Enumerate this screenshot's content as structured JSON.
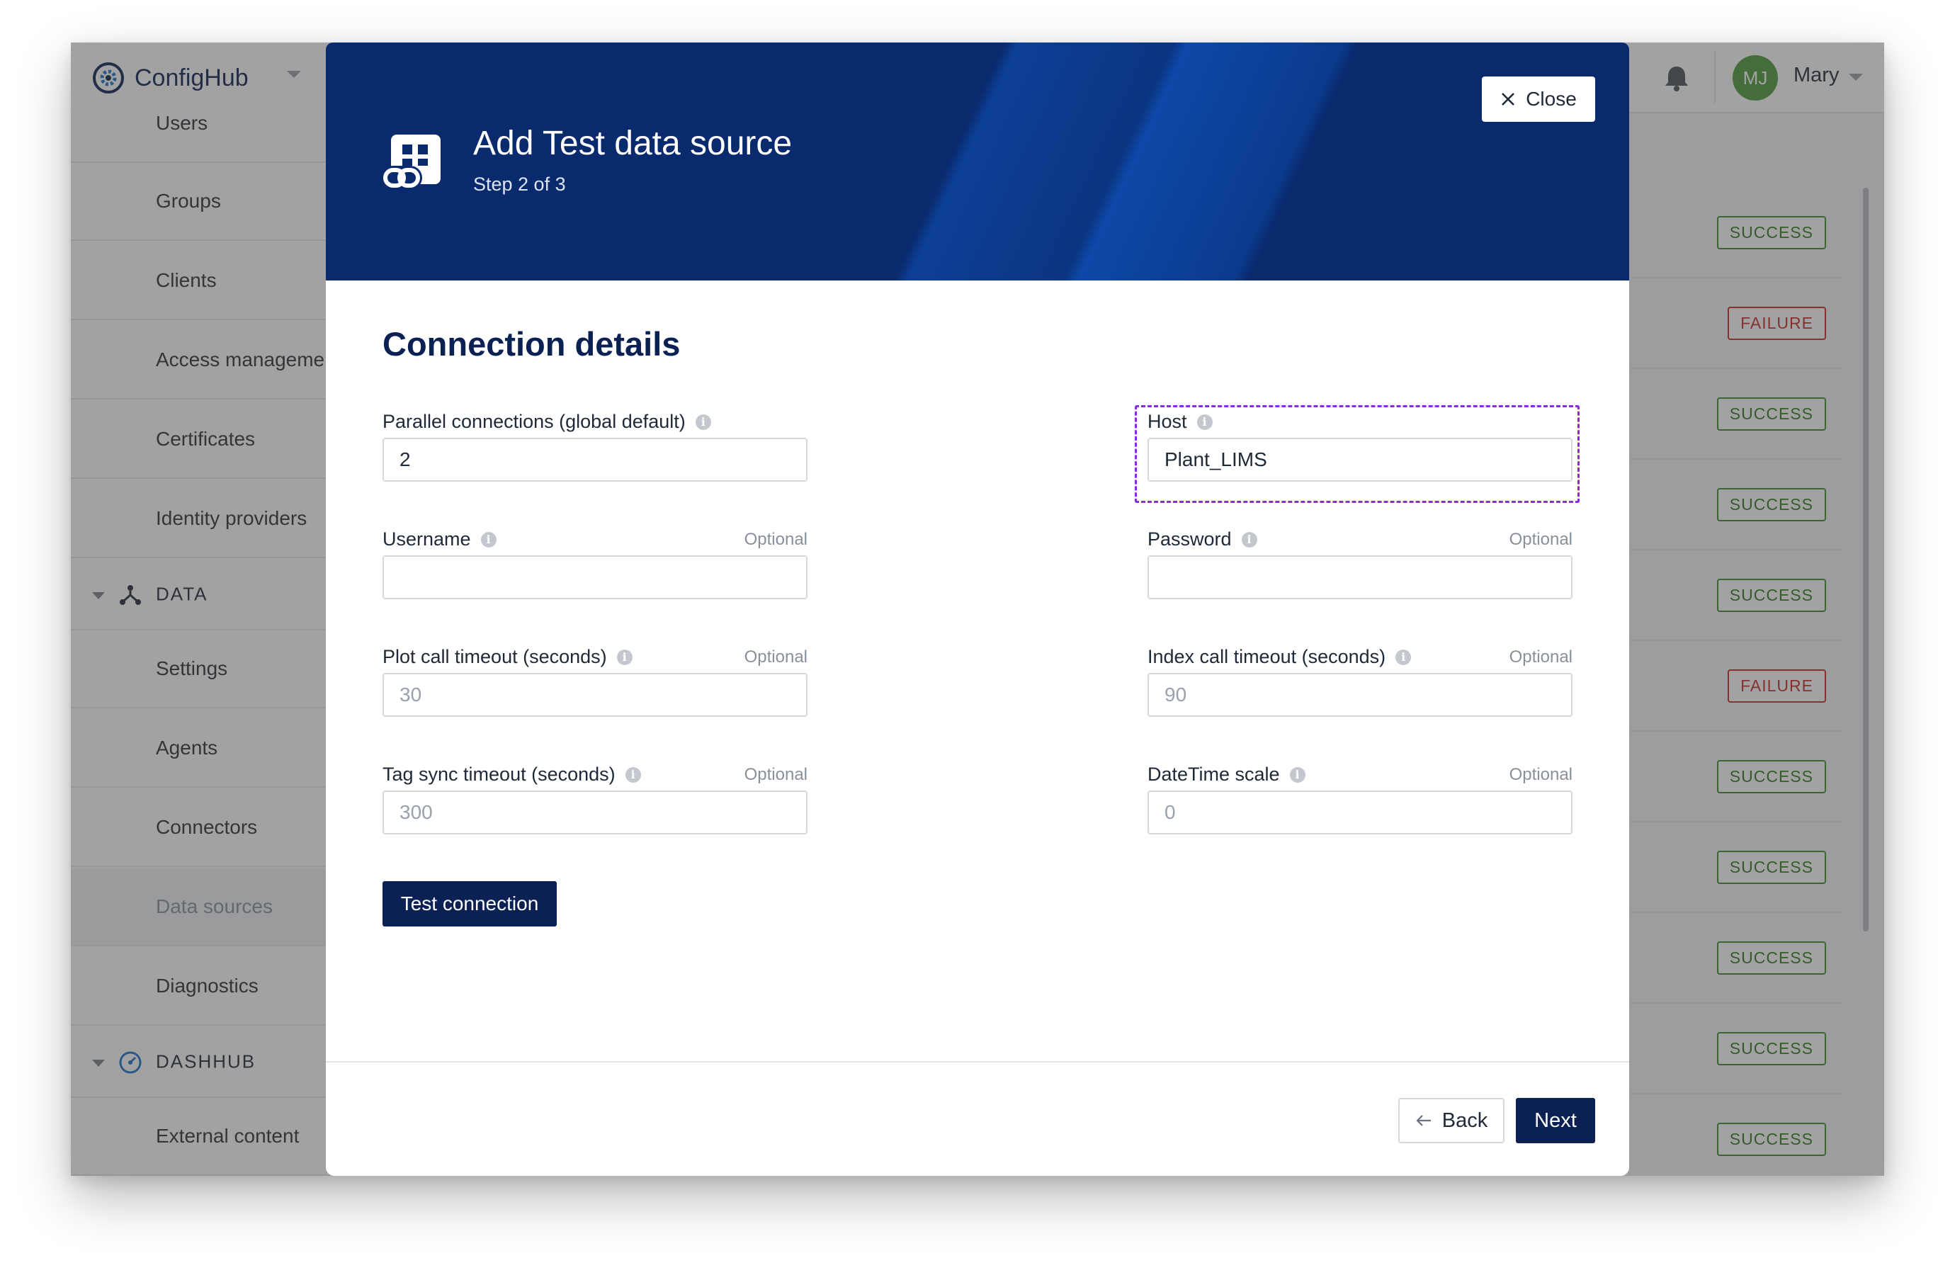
{
  "app": {
    "brand_name": "ConfigHub",
    "logo_icon": "gear-logo-icon",
    "notifications_icon": "bell-icon"
  },
  "user": {
    "initials": "MJ",
    "name": "Mary",
    "avatar_color": "#4e9a3a"
  },
  "sidebar": {
    "items_top": [
      {
        "label": "Users"
      },
      {
        "label": "Groups"
      },
      {
        "label": "Clients"
      },
      {
        "label": "Access management"
      },
      {
        "label": "Certificates"
      },
      {
        "label": "Identity providers"
      }
    ],
    "section_data": {
      "label": "DATA",
      "icon": "data-nodes-icon"
    },
    "items_data": [
      {
        "label": "Settings"
      },
      {
        "label": "Agents"
      },
      {
        "label": "Connectors"
      },
      {
        "label": "Data sources",
        "active": true
      },
      {
        "label": "Diagnostics"
      }
    ],
    "section_dashhub": {
      "label": "DASHHUB",
      "icon": "gauge-icon"
    },
    "items_dashhub": [
      {
        "label": "External content"
      }
    ]
  },
  "status_list": [
    {
      "status": "SUCCESS"
    },
    {
      "status": "FAILURE"
    },
    {
      "status": "SUCCESS"
    },
    {
      "status": "SUCCESS"
    },
    {
      "status": "SUCCESS"
    },
    {
      "status": "FAILURE"
    },
    {
      "status": "SUCCESS"
    },
    {
      "status": "SUCCESS"
    },
    {
      "status": "SUCCESS"
    },
    {
      "status": "SUCCESS"
    },
    {
      "status": "SUCCESS"
    }
  ],
  "colors": {
    "brand_navy": "#0b2154",
    "success": "#2f7a1f",
    "failure": "#c62828",
    "focus_outline": "#8a2be2"
  },
  "modal": {
    "title": "Add Test data source",
    "step": "Step 2 of 3",
    "close_label": "Close",
    "header_icon": "data-source-link-icon",
    "section_title": "Connection details",
    "fields": {
      "parallel": {
        "label": "Parallel connections (global default)",
        "value": "2",
        "optional": ""
      },
      "host": {
        "label": "Host",
        "value": "Plant_LIMS",
        "optional": ""
      },
      "username": {
        "label": "Username",
        "value": "",
        "optional": "Optional"
      },
      "password": {
        "label": "Password",
        "value": "",
        "optional": "Optional"
      },
      "plot_timeout": {
        "label": "Plot call timeout (seconds)",
        "placeholder": "30",
        "optional": "Optional"
      },
      "index_timeout": {
        "label": "Index call timeout (seconds)",
        "placeholder": "90",
        "optional": "Optional"
      },
      "tag_sync_timeout": {
        "label": "Tag sync timeout (seconds)",
        "placeholder": "300",
        "optional": "Optional"
      },
      "datetime_scale": {
        "label": "DateTime scale",
        "placeholder": "0",
        "optional": "Optional"
      }
    },
    "test_connection_label": "Test connection",
    "back_label": "Back",
    "next_label": "Next"
  }
}
